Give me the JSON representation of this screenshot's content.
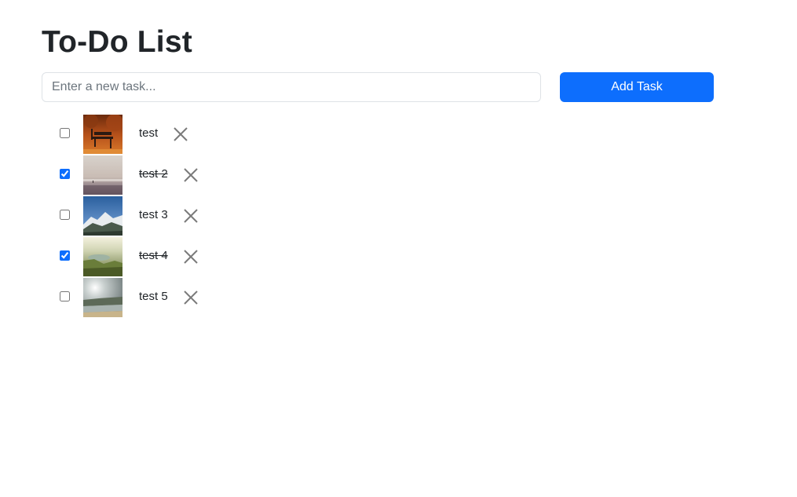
{
  "page": {
    "title": "To-Do List"
  },
  "form": {
    "input_placeholder": "Enter a new task...",
    "input_value": "",
    "add_button_label": "Add Task"
  },
  "colors": {
    "primary": "#0d6efd",
    "text": "#212529",
    "delete_icon": "#7a7a7a"
  },
  "tasks": [
    {
      "text": "test",
      "completed": false,
      "image": "autumn-bench-photo",
      "delete_icon": "close-icon"
    },
    {
      "text": "test 2",
      "completed": true,
      "image": "misty-beach-photo",
      "delete_icon": "close-icon"
    },
    {
      "text": "test 3",
      "completed": false,
      "image": "snowy-mountain-photo",
      "delete_icon": "close-icon"
    },
    {
      "text": "test 4",
      "completed": true,
      "image": "green-valley-photo",
      "delete_icon": "close-icon"
    },
    {
      "text": "test 5",
      "completed": false,
      "image": "sunny-coast-photo",
      "delete_icon": "close-icon"
    }
  ]
}
